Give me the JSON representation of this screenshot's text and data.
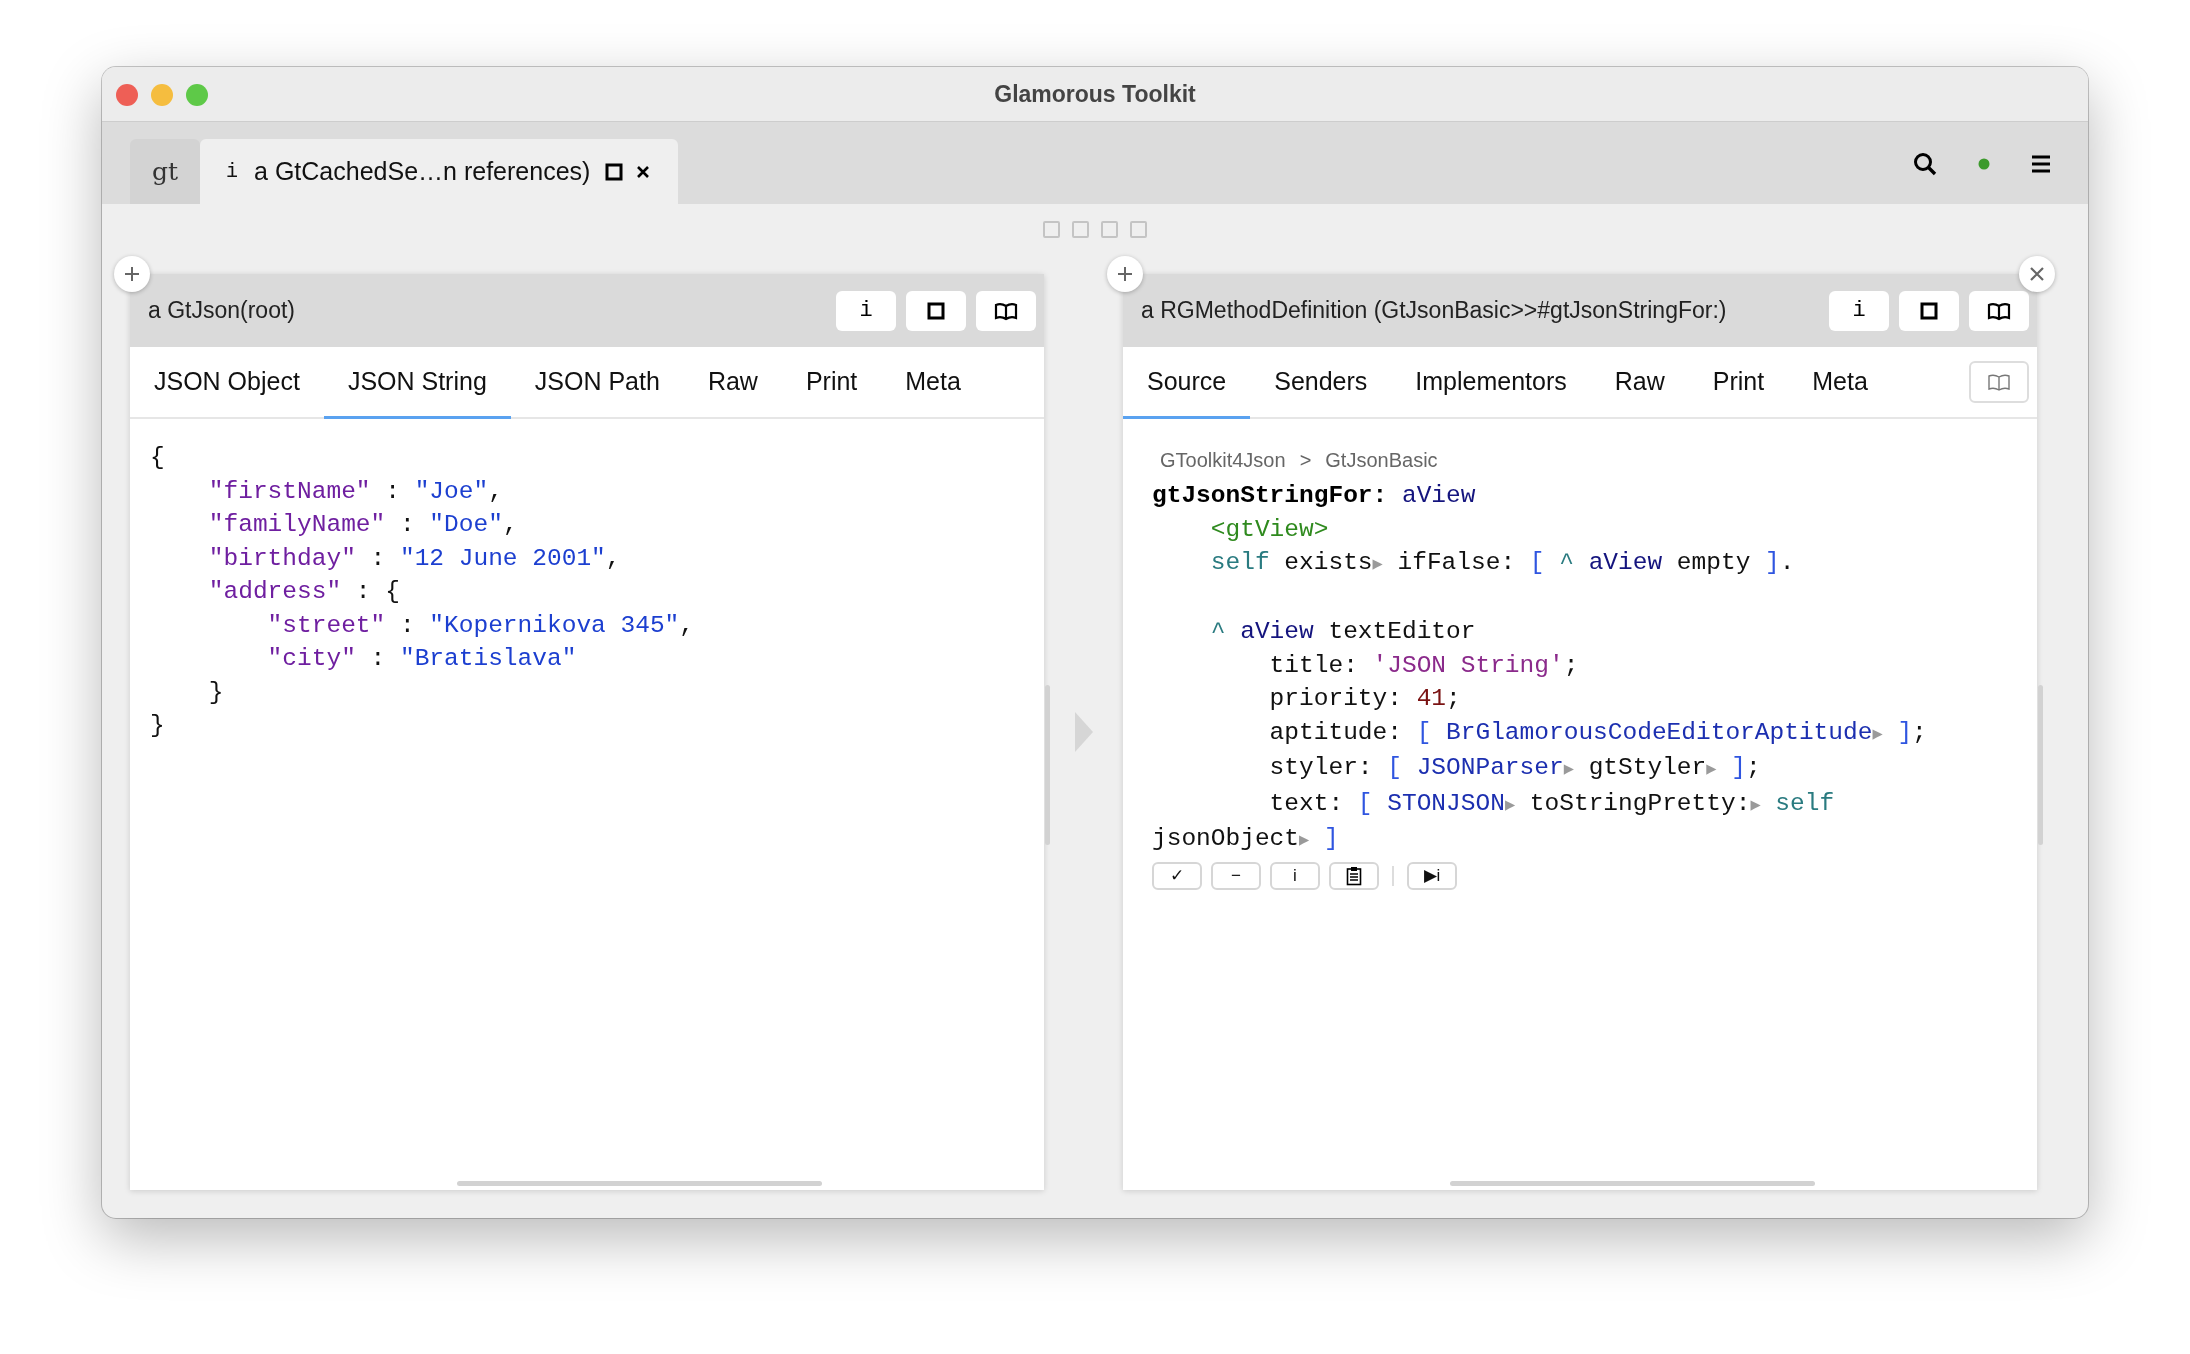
{
  "window": {
    "title": "Glamorous Toolkit"
  },
  "tabs": [
    {
      "kind": "logo",
      "label": "gt",
      "selected": false
    },
    {
      "kind": "page",
      "prefix": "i",
      "label": "a GtCachedSe…n references)",
      "selected": true
    }
  ],
  "panes": [
    {
      "title": "a GtJson(root)",
      "closable": false,
      "buttons": [
        {
          "kind": "text",
          "label": "i"
        },
        {
          "kind": "maximize"
        },
        {
          "kind": "book"
        }
      ],
      "tabs": [
        {
          "label": "JSON Object",
          "selected": false
        },
        {
          "label": "JSON String",
          "selected": true
        },
        {
          "label": "JSON Path",
          "selected": false
        },
        {
          "label": "Raw",
          "selected": false
        },
        {
          "label": "Print",
          "selected": false
        },
        {
          "label": "Meta",
          "selected": false
        }
      ],
      "lines": [
        {
          "tokens": [
            {
              "kind": "plain",
              "text": "{"
            }
          ]
        },
        {
          "tokens": [
            {
              "kind": "key",
              "text": "    \"firstName\""
            },
            {
              "kind": "plain",
              "text": " : "
            },
            {
              "kind": "string",
              "text": "\"Joe\""
            },
            {
              "kind": "plain",
              "text": ","
            }
          ]
        },
        {
          "tokens": [
            {
              "kind": "key",
              "text": "    \"familyName\""
            },
            {
              "kind": "plain",
              "text": " : "
            },
            {
              "kind": "string",
              "text": "\"Doe\""
            },
            {
              "kind": "plain",
              "text": ","
            }
          ]
        },
        {
          "tokens": [
            {
              "kind": "key",
              "text": "    \"birthday\""
            },
            {
              "kind": "plain",
              "text": " : "
            },
            {
              "kind": "string",
              "text": "\"12 June 2001\""
            },
            {
              "kind": "plain",
              "text": ","
            }
          ]
        },
        {
          "tokens": [
            {
              "kind": "key",
              "text": "    \"address\""
            },
            {
              "kind": "plain",
              "text": " : {"
            }
          ]
        },
        {
          "tokens": [
            {
              "kind": "key",
              "text": "        \"street\""
            },
            {
              "kind": "plain",
              "text": " : "
            },
            {
              "kind": "string",
              "text": "\"Kopernikova 345\""
            },
            {
              "kind": "plain",
              "text": ","
            }
          ]
        },
        {
          "tokens": [
            {
              "kind": "key",
              "text": "        \"city\""
            },
            {
              "kind": "plain",
              "text": " : "
            },
            {
              "kind": "string",
              "text": "\"Bratislava\""
            }
          ]
        },
        {
          "tokens": [
            {
              "kind": "plain",
              "text": "    }"
            }
          ]
        },
        {
          "tokens": [
            {
              "kind": "plain",
              "text": "}"
            }
          ]
        }
      ]
    },
    {
      "title": "a RGMethodDefinition (GtJsonBasic>>#gtJsonStringFor:)",
      "closable": true,
      "buttons": [
        {
          "kind": "text",
          "label": "i"
        },
        {
          "kind": "maximize"
        },
        {
          "kind": "book"
        }
      ],
      "tabs": [
        {
          "label": "Source",
          "selected": true
        },
        {
          "label": "Senders",
          "selected": false
        },
        {
          "label": "Implementors",
          "selected": false
        },
        {
          "label": "Raw",
          "selected": false
        },
        {
          "label": "Print",
          "selected": false
        },
        {
          "label": "Meta",
          "selected": false
        }
      ],
      "breadcrumb": [
        "GToolkit4Json",
        ">",
        "GtJsonBasic"
      ],
      "lines": [
        {
          "tokens": [
            {
              "kind": "selector",
              "text": "gtJsonStringFor:"
            },
            {
              "kind": "var",
              "text": " aView"
            }
          ]
        },
        {
          "tokens": [
            {
              "kind": "pragma",
              "text": "    <gtView>"
            }
          ]
        },
        {
          "tokens": [
            {
              "kind": "self",
              "text": "    self"
            },
            {
              "kind": "plain",
              "text": " exists"
            },
            {
              "kind": "marker",
              "text": "▶"
            },
            {
              "kind": "plain",
              "text": " ifFalse: "
            },
            {
              "kind": "bracket",
              "text": "["
            },
            {
              "kind": "caret",
              "text": " ^"
            },
            {
              "kind": "var",
              "text": " aView"
            },
            {
              "kind": "plain",
              "text": " empty "
            },
            {
              "kind": "bracket",
              "text": "]"
            },
            {
              "kind": "plain",
              "text": "."
            }
          ]
        },
        {
          "blank_before": true,
          "tokens": [
            {
              "kind": "caret",
              "text": "    ^"
            },
            {
              "kind": "var",
              "text": " aView"
            },
            {
              "kind": "plain",
              "text": " textEditor"
            }
          ]
        },
        {
          "tokens": [
            {
              "kind": "plain",
              "text": "        title: "
            },
            {
              "kind": "literal",
              "text": "'JSON String'"
            },
            {
              "kind": "plain",
              "text": ";"
            }
          ]
        },
        {
          "tokens": [
            {
              "kind": "plain",
              "text": "        priority: "
            },
            {
              "kind": "number",
              "text": "41"
            },
            {
              "kind": "plain",
              "text": ";"
            }
          ]
        },
        {
          "tokens": [
            {
              "kind": "plain",
              "text": "        aptitude: "
            },
            {
              "kind": "bracket",
              "text": "["
            },
            {
              "kind": "class",
              "text": " BrGlamorousCodeEditorAptitude"
            },
            {
              "kind": "marker",
              "text": "▶"
            },
            {
              "kind": "bracket",
              "text": " ]"
            },
            {
              "kind": "plain",
              "text": ";"
            }
          ]
        },
        {
          "tokens": [
            {
              "kind": "plain",
              "text": "        styler: "
            },
            {
              "kind": "bracket",
              "text": "["
            },
            {
              "kind": "class",
              "text": " JSONParser"
            },
            {
              "kind": "marker",
              "text": "▶"
            },
            {
              "kind": "plain",
              "text": " gtStyler"
            },
            {
              "kind": "marker",
              "text": "▶"
            },
            {
              "kind": "bracket",
              "text": " ]"
            },
            {
              "kind": "plain",
              "text": ";"
            }
          ]
        },
        {
          "tokens": [
            {
              "kind": "plain",
              "text": "        text: "
            },
            {
              "kind": "bracket",
              "text": "["
            },
            {
              "kind": "class",
              "text": " STONJSON"
            },
            {
              "kind": "marker",
              "text": "▶"
            },
            {
              "kind": "plain",
              "text": " toStringPretty:"
            },
            {
              "kind": "marker",
              "text": "▶"
            },
            {
              "kind": "self",
              "text": " self"
            }
          ]
        },
        {
          "tokens": [
            {
              "kind": "plain",
              "text": "jsonObject"
            },
            {
              "kind": "marker",
              "text": "▶"
            },
            {
              "kind": "bracket",
              "text": " ]"
            }
          ]
        }
      ],
      "actions": [
        {
          "kind": "text",
          "label": "✓"
        },
        {
          "kind": "text",
          "label": "−"
        },
        {
          "kind": "text",
          "label": "i"
        },
        {
          "kind": "clipboard"
        },
        {
          "kind": "separator"
        },
        {
          "kind": "text",
          "label": "▶i"
        }
      ]
    }
  ]
}
